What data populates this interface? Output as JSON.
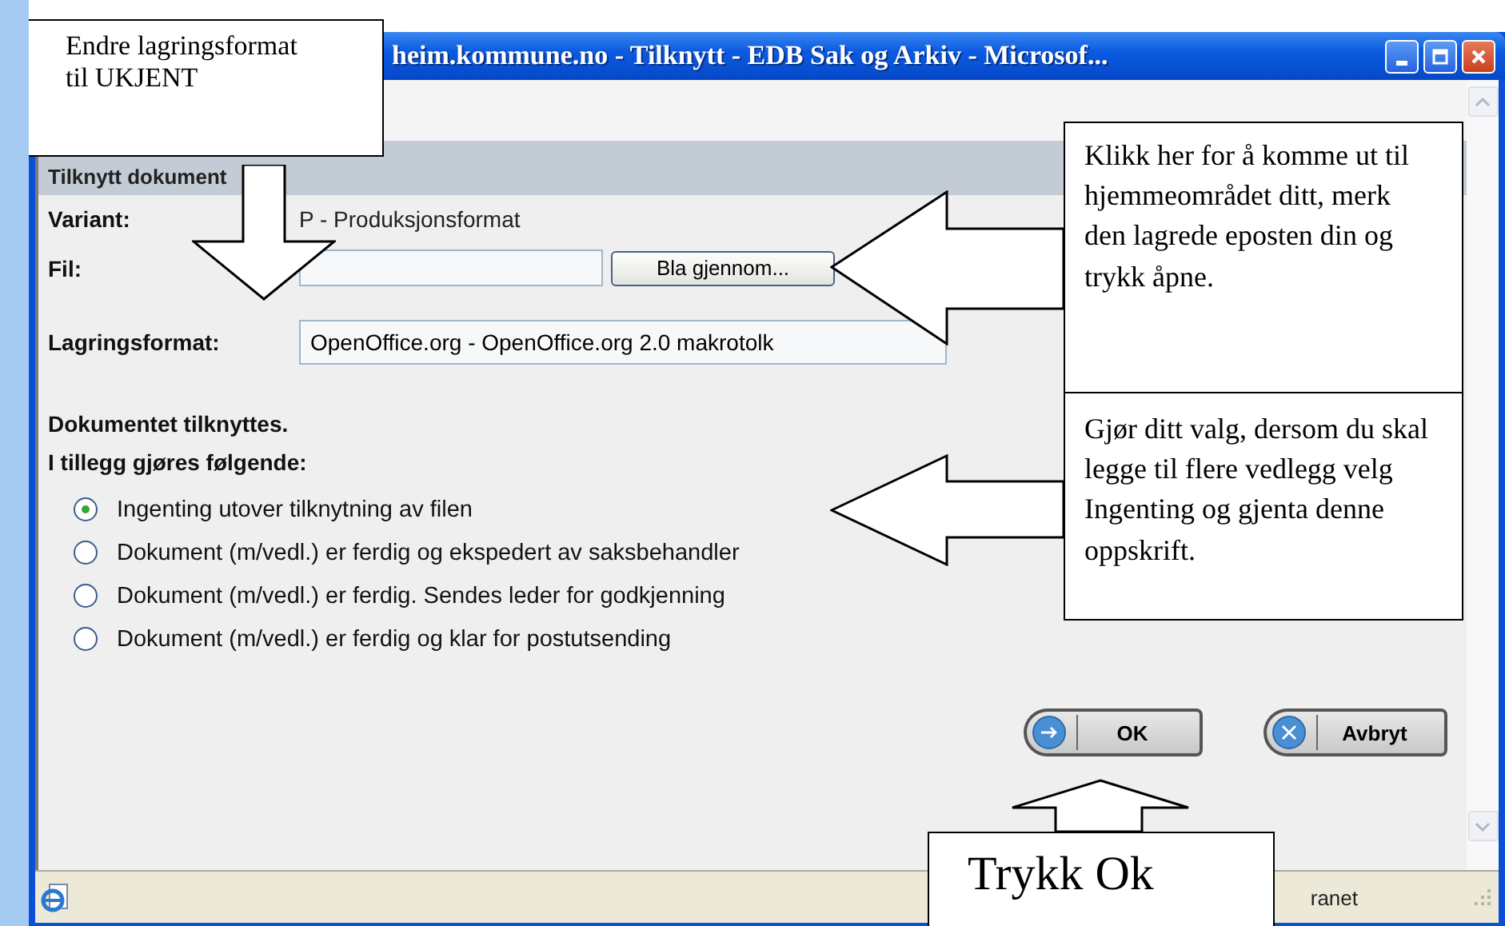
{
  "window": {
    "title": "heim.kommune.no - Tilknytt - EDB Sak og Arkiv - Microsof..."
  },
  "section": {
    "title": "Tilknytt dokument"
  },
  "fields": [
    {
      "kind": "text",
      "label": "Variant:",
      "value": "P - Produksjonsformat"
    },
    {
      "kind": "file",
      "label": "Fil:",
      "button": "Bla gjennom..."
    },
    {
      "kind": "select",
      "label": "Lagringsformat:",
      "value": "OpenOffice.org - OpenOffice.org 2.0 makrotolk"
    }
  ],
  "intro": [
    "Dokumentet tilknyttes.",
    "I tillegg gjøres følgende:"
  ],
  "options": [
    {
      "label": "Ingenting utover tilknytning av filen",
      "selected": true
    },
    {
      "label": "Dokument (m/vedl.) er ferdig og ekspedert av saksbehandler",
      "selected": false
    },
    {
      "label": "Dokument (m/vedl.) er ferdig. Sendes leder for godkjenning",
      "selected": false
    },
    {
      "label": "Dokument (m/vedl.) er ferdig og klar for postutsending",
      "selected": false
    }
  ],
  "buttons": [
    {
      "kind": "ok",
      "label": "OK"
    },
    {
      "kind": "cancel",
      "label": "Avbryt"
    }
  ],
  "status_bar": {
    "zone": "ranet"
  },
  "callouts": [
    {
      "kind": "down",
      "text": "Endre lagringsformat til UKJENT"
    },
    {
      "kind": "left",
      "text": "Klikk her for å komme ut til hjemmeområdet ditt, merk den lagrede eposten din og trykk åpne."
    },
    {
      "kind": "left",
      "text": "Gjør ditt valg, dersom du skal legge til flere vedlegg velg Ingenting og gjenta denne oppskrift."
    },
    {
      "kind": "up",
      "text": "Trykk Ok"
    }
  ]
}
